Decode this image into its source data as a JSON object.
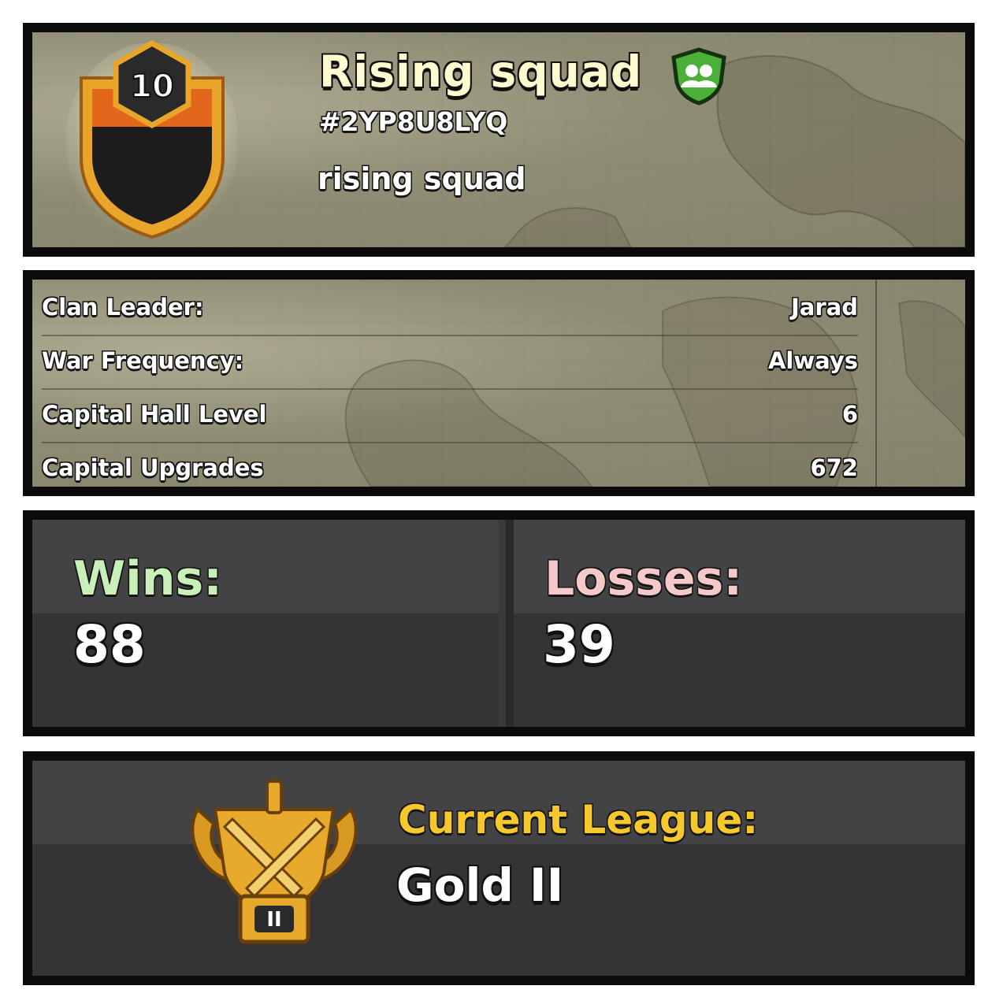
{
  "clan": {
    "level": "10",
    "name": "Rising squad",
    "tag": "#2YP8U8LYQ",
    "description": "rising squad",
    "badge_colors": {
      "gold": "#e8a92b",
      "orange": "#e3661d",
      "black": "#1a1a1a"
    },
    "type_icon": "shield-group-icon"
  },
  "details": {
    "rows": [
      {
        "label": "Clan Leader:",
        "value": "Jarad"
      },
      {
        "label": "War Frequency:",
        "value": "Always"
      },
      {
        "label": "Capital Hall Level",
        "value": "6"
      },
      {
        "label": "Capital Upgrades",
        "value": "672"
      }
    ]
  },
  "war_stats": {
    "wins_label": "Wins:",
    "wins": "88",
    "losses_label": "Losses:",
    "losses": "39",
    "wins_color": "#c9f0b8",
    "losses_color": "#f5c9c9"
  },
  "league": {
    "label": "Current League:",
    "value": "Gold II",
    "badge_text": "II",
    "label_color": "#f6c82b",
    "icon": "gold-league-trophy-icon"
  }
}
